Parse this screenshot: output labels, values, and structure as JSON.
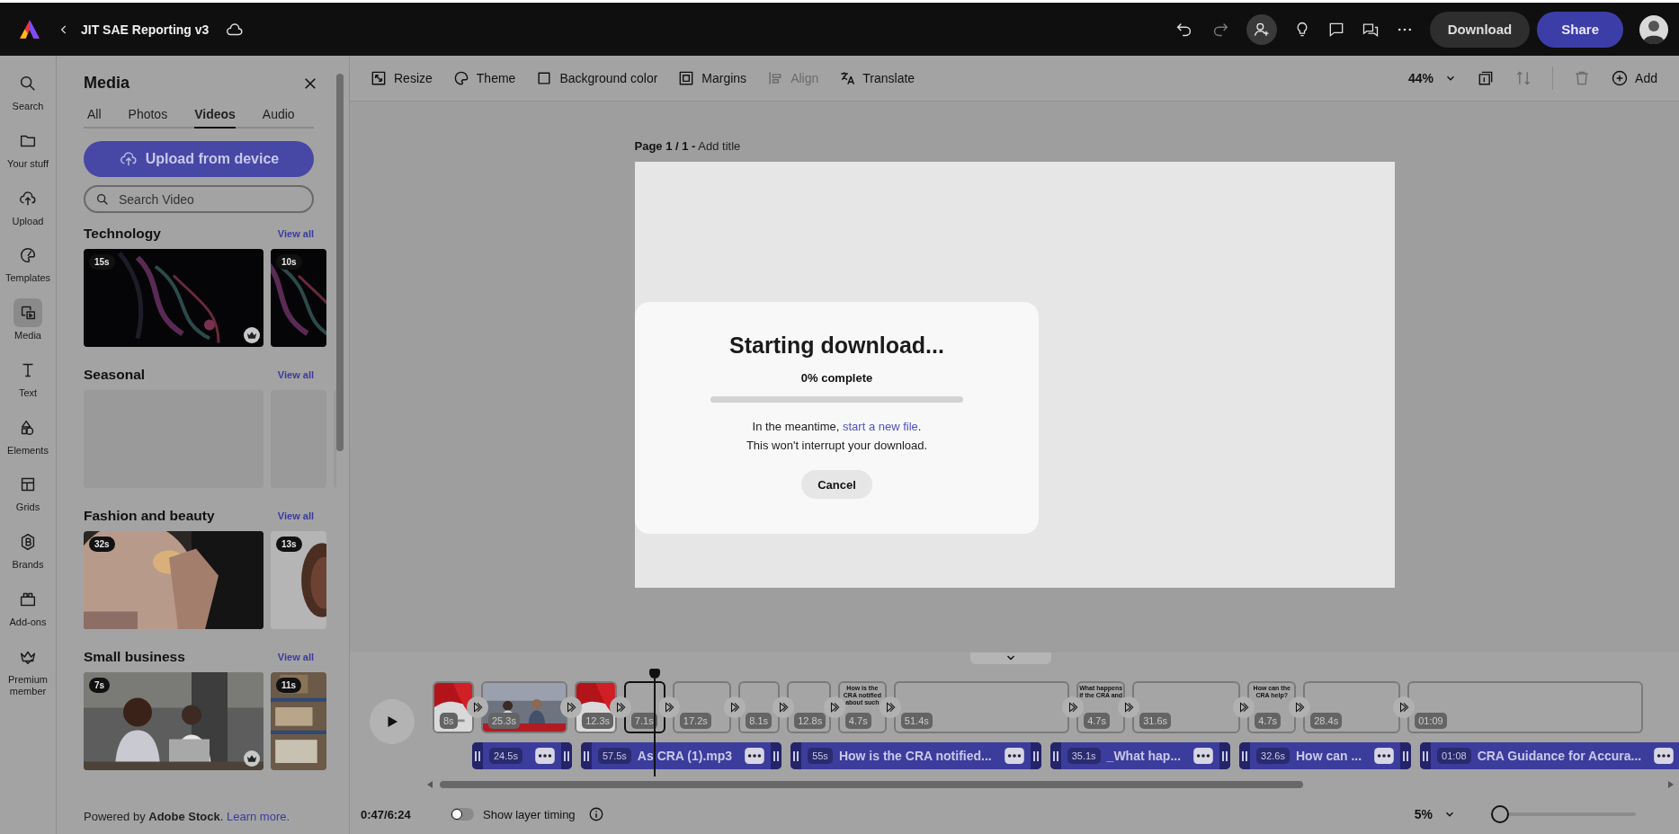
{
  "app_bar": {
    "title": "JIT SAE Reporting v3",
    "download": "Download",
    "share": "Share"
  },
  "rail": [
    {
      "label": "Search",
      "selected": false
    },
    {
      "label": "Your stuff",
      "selected": false
    },
    {
      "label": "Upload",
      "selected": false
    },
    {
      "label": "Templates",
      "selected": false
    },
    {
      "label": "Media",
      "selected": true
    },
    {
      "label": "Text",
      "selected": false
    },
    {
      "label": "Elements",
      "selected": false
    },
    {
      "label": "Grids",
      "selected": false
    },
    {
      "label": "Brands",
      "selected": false
    },
    {
      "label": "Add-ons",
      "selected": false
    },
    {
      "label": "Premium member",
      "selected": false
    }
  ],
  "media_panel": {
    "title": "Media",
    "tabs": [
      {
        "label": "All",
        "selected": false
      },
      {
        "label": "Photos",
        "selected": false
      },
      {
        "label": "Videos",
        "selected": true
      },
      {
        "label": "Audio",
        "selected": false
      }
    ],
    "upload_button": "Upload from device",
    "search": {
      "placeholder": "Search Video"
    },
    "sections": [
      {
        "title": "Technology",
        "link": "View all",
        "tiles": [
          {
            "kind": "abstract",
            "duration": "15s",
            "premium": true
          },
          {
            "kind": "abstract",
            "duration": "10s",
            "premium": false
          }
        ]
      },
      {
        "title": "Seasonal",
        "link": "View all",
        "tiles": [
          {
            "kind": "empty",
            "premium": false
          },
          {
            "kind": "empty",
            "premium": false
          },
          {
            "kind": "empty",
            "premium": false
          }
        ]
      },
      {
        "title": "Fashion and beauty",
        "link": "View all",
        "tiles": [
          {
            "kind": "beauty",
            "duration": "32s",
            "premium": false
          },
          {
            "kind": "portrait",
            "duration": "13s",
            "premium": false
          }
        ]
      },
      {
        "title": "Small business",
        "link": "View all",
        "tiles": [
          {
            "kind": "office",
            "duration": "7s",
            "premium": true
          },
          {
            "kind": "warehouse",
            "duration": "11s",
            "premium": false
          }
        ]
      }
    ],
    "footer": {
      "text": "Powered by **Adobe Stock**.",
      "link": "Learn more."
    }
  },
  "toolbar": {
    "items": [
      {
        "label": "Resize",
        "disabled": false
      },
      {
        "label": "Theme",
        "disabled": false
      },
      {
        "label": "Background color",
        "disabled": false
      },
      {
        "label": "Margins",
        "disabled": false
      },
      {
        "label": "Align",
        "disabled": true
      },
      {
        "label": "Translate",
        "disabled": false
      }
    ],
    "zoom": "44%",
    "add": "Add"
  },
  "canvas": {
    "page_label": "Page 1 / 1 -",
    "add_title": "Add title"
  },
  "timeline": {
    "clips": [
      {
        "kind": "red",
        "duration": "8s",
        "selected": false
      },
      {
        "kind": "office",
        "duration": "25.3s",
        "selected": false
      },
      {
        "kind": "red",
        "duration": "12.3s",
        "selected": false
      },
      {
        "kind": "blank",
        "duration": "7.1s",
        "selected": true
      },
      {
        "kind": "blank",
        "duration": "17.2s",
        "selected": false
      },
      {
        "kind": "blank",
        "duration": "8.1s",
        "selected": false
      },
      {
        "kind": "blank",
        "duration": "12.8s",
        "selected": false
      },
      {
        "kind": "text",
        "duration": "4.7s",
        "caption": "How is the CRA notified about such",
        "selected": false
      },
      {
        "kind": "blank",
        "duration": "51.4s",
        "selected": false
      },
      {
        "kind": "text",
        "duration": "4.7s",
        "caption": "What happens if the CRA and",
        "selected": false
      },
      {
        "kind": "blank",
        "duration": "31.6s",
        "selected": false
      },
      {
        "kind": "text",
        "duration": "4.7s",
        "caption": "How can the CRA help?",
        "selected": false
      },
      {
        "kind": "blank",
        "duration": "28.4s",
        "selected": false
      },
      {
        "kind": "blank",
        "duration": "01:09",
        "selected": false
      }
    ],
    "audio": [
      {
        "duration": "24.5s"
      },
      {
        "duration": "57.5s",
        "name": "As CRA (1).mp3"
      },
      {
        "duration": "55s",
        "name": "How is the CRA notified..."
      },
      {
        "duration": "35.1s",
        "name": "_What hap..."
      },
      {
        "duration": "32.6s",
        "name": "How can ..."
      },
      {
        "duration": "01:08",
        "name": "CRA Guidance for Accura..."
      }
    ],
    "time": "0:47/6:24",
    "layer_timing": {
      "label": "Show layer timing",
      "on": false
    },
    "zoom": {
      "value": "5%",
      "level": 0
    }
  },
  "dialog": {
    "title": "Starting download...",
    "progress_text": "0% complete",
    "level": 0,
    "message": {
      "before": "In the meantime, ",
      "link": "start a new file",
      "after": "."
    },
    "note": "This won't interrupt your download.",
    "cancel": "Cancel"
  }
}
